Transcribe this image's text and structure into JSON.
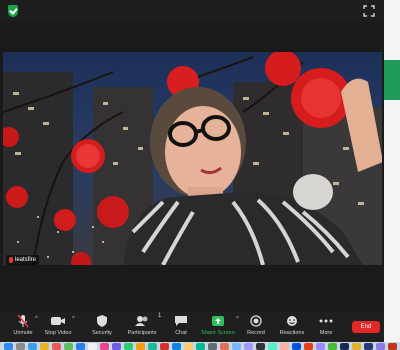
{
  "participant": {
    "name": "leatsfire"
  },
  "toolbar": {
    "unmute": "Unmute",
    "stop_video": "Stop Video",
    "security": "Security",
    "participants": "Participants",
    "participants_count": "1",
    "chat": "Chat",
    "share_screen": "Share Screen",
    "record": "Record",
    "reactions": "Reactions",
    "more": "More",
    "end": "End"
  },
  "colors": {
    "end_button": "#e02828",
    "share_screen": "#2fbf5a",
    "encryption_shield": "#1aa34a"
  },
  "icons": {
    "title_left": "shield-check-icon",
    "title_right": "fullscreen-icon"
  }
}
